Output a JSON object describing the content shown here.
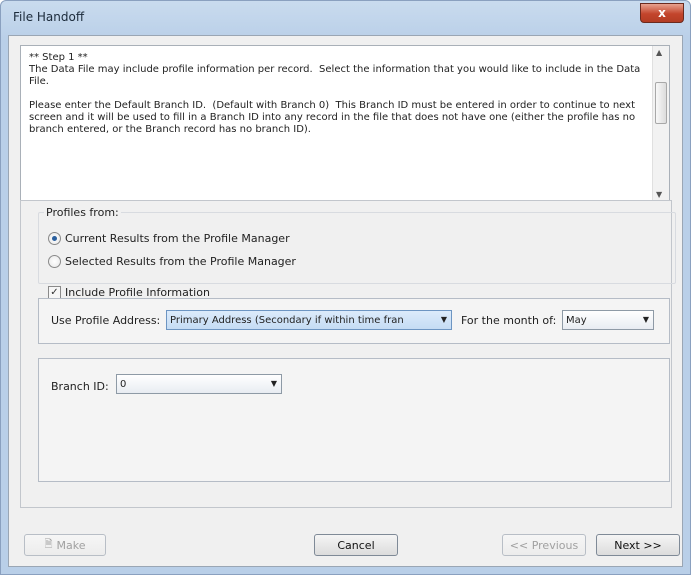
{
  "window": {
    "title": "File Handoff",
    "close_label": "x"
  },
  "description": {
    "text": "** Step 1 **\nThe Data File may include profile information per record.  Select the information that you would like to include in the Data File.\n\nPlease enter the Default Branch ID.  (Default with Branch 0)  This Branch ID must be entered in order to continue to next screen and it will be used to fill in a Branch ID into any record in the file that does not have one (either the profile has no branch entered, or the Branch record has no branch ID)."
  },
  "profiles": {
    "legend": "Profiles from:",
    "option_current": "Current Results from the Profile Manager",
    "option_selected": "Selected Results from the Profile Manager",
    "selected": "current"
  },
  "include_profile": {
    "label": "Include Profile Information",
    "checked": true
  },
  "address": {
    "label": "Use Profile Address:",
    "value": "Primary Address (Secondary if within time fran",
    "month_label": "For the month of:",
    "month_value": "May"
  },
  "branch": {
    "label": "Branch ID:",
    "value": "0"
  },
  "buttons": {
    "make": "Make",
    "cancel": "Cancel",
    "previous": "<< Previous",
    "next": "Next >>"
  }
}
